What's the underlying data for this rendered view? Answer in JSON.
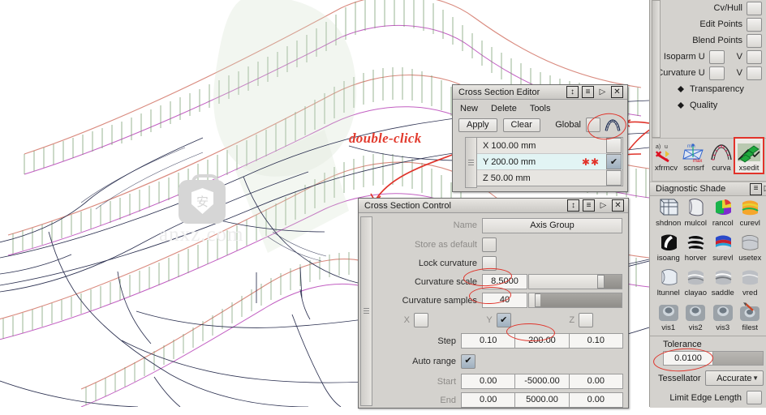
{
  "annotation": {
    "double_click": "double-click"
  },
  "watermark": {
    "glyph": "安",
    "text": "anxz.com"
  },
  "cross_section_editor": {
    "title": "Cross Section Editor",
    "menu": [
      "New",
      "Delete",
      "Tools"
    ],
    "apply_label": "Apply",
    "clear_label": "Clear",
    "global_label": "Global",
    "global_checked": false,
    "arch_icon": "curvature-comb-icon",
    "titlebar_icons": [
      "resize-icon",
      "menu-icon",
      "collapse-icon",
      "close-icon"
    ],
    "rows": [
      {
        "label": "X 100.00 mm",
        "checked": false,
        "stars": "",
        "selected": false
      },
      {
        "label": "Y 200.00 mm",
        "checked": true,
        "stars": "✱✱",
        "selected": true
      },
      {
        "label": "Z 50.00 mm",
        "checked": false,
        "stars": "",
        "selected": false
      }
    ]
  },
  "cross_section_control": {
    "title": "Cross Section Control",
    "titlebar_icons": [
      "resize-icon",
      "menu-icon",
      "collapse-icon",
      "close-icon"
    ],
    "name_label": "Name",
    "name_value": "Axis Group",
    "store_label": "Store as default",
    "store_checked": false,
    "lock_label": "Lock curvature",
    "lock_checked": false,
    "curvature_scale_label": "Curvature scale",
    "curvature_scale_value": "8.5000",
    "curvature_scale_pct": 76,
    "curvature_samples_label": "Curvature samples",
    "curvature_samples_value": "40",
    "curvature_samples_pct": 8,
    "axes": [
      {
        "name": "X",
        "checked": false
      },
      {
        "name": "Y",
        "checked": true
      },
      {
        "name": "Z",
        "checked": false
      }
    ],
    "step_label": "Step",
    "step_values": [
      "0.10",
      "200.00",
      "0.10"
    ],
    "auto_range_label": "Auto range",
    "auto_range_checked": true,
    "start_label": "Start",
    "start_values": [
      "0.00",
      "-5000.00",
      "0.00"
    ],
    "end_label": "End",
    "end_values": [
      "0.00",
      "5000.00",
      "0.00"
    ]
  },
  "sidebar": {
    "options": [
      {
        "label": "Cv/Hull",
        "checked": false,
        "second": null
      },
      {
        "label": "Edit Points",
        "checked": false,
        "second": null
      },
      {
        "label": "Blend Points",
        "checked": false,
        "second": null
      },
      {
        "label": "Isoparm U",
        "checked": false,
        "second": "V"
      },
      {
        "label": "Curvature U",
        "checked": false,
        "second": "V"
      }
    ],
    "bullets": [
      "Transparency",
      "Quality"
    ],
    "tools": [
      {
        "name": "xfrmcv",
        "icon": "transform-curve-icon",
        "selected": false
      },
      {
        "name": "scnsrf",
        "icon": "scan-surface-icon",
        "selected": false
      },
      {
        "name": "curva",
        "icon": "curvature-icon",
        "selected": false
      },
      {
        "name": "xsedit",
        "icon": "cross-section-edit-icon",
        "selected": true
      }
    ],
    "diagnostic_header": "Diagnostic Shade",
    "shade_icons": [
      {
        "name": "shdnon",
        "icon": "shade-none-icon"
      },
      {
        "name": "mulcol",
        "icon": "multi-color-icon"
      },
      {
        "name": "rancol",
        "icon": "random-color-icon"
      },
      {
        "name": "curevl",
        "icon": "curvature-eval-icon"
      },
      {
        "name": "isoang",
        "icon": "iso-angle-icon"
      },
      {
        "name": "horver",
        "icon": "horizontal-vertical-icon"
      },
      {
        "name": "surevl",
        "icon": "surface-eval-icon"
      },
      {
        "name": "usetex",
        "icon": "use-texture-icon"
      },
      {
        "name": "ltunnel",
        "icon": "light-tunnel-icon"
      },
      {
        "name": "clayao",
        "icon": "clay-ao-icon"
      },
      {
        "name": "saddle",
        "icon": "saddle-icon"
      },
      {
        "name": "vred",
        "icon": "vred-icon"
      },
      {
        "name": "vis1",
        "icon": "visualize-1-icon"
      },
      {
        "name": "vis2",
        "icon": "visualize-2-icon"
      },
      {
        "name": "vis3",
        "icon": "visualize-3-icon"
      },
      {
        "name": "filest",
        "icon": "file-settings-icon"
      }
    ],
    "tolerance_label": "Tolerance",
    "tolerance_value": "0.0100",
    "tessellator_label": "Tessellator",
    "tessellator_value": "Accurate",
    "limit_edge_label": "Limit Edge Length",
    "limit_edge_checked": false
  },
  "colors": {
    "comb_envelope": "#d98a7e",
    "comb_quills": "#6f9668",
    "base_curve": "#c25fc2",
    "wireframe": "#2b3050",
    "accent_red": "#e2332a",
    "panel": "#d4d2ce",
    "selected_row": "#e2f4f4"
  }
}
